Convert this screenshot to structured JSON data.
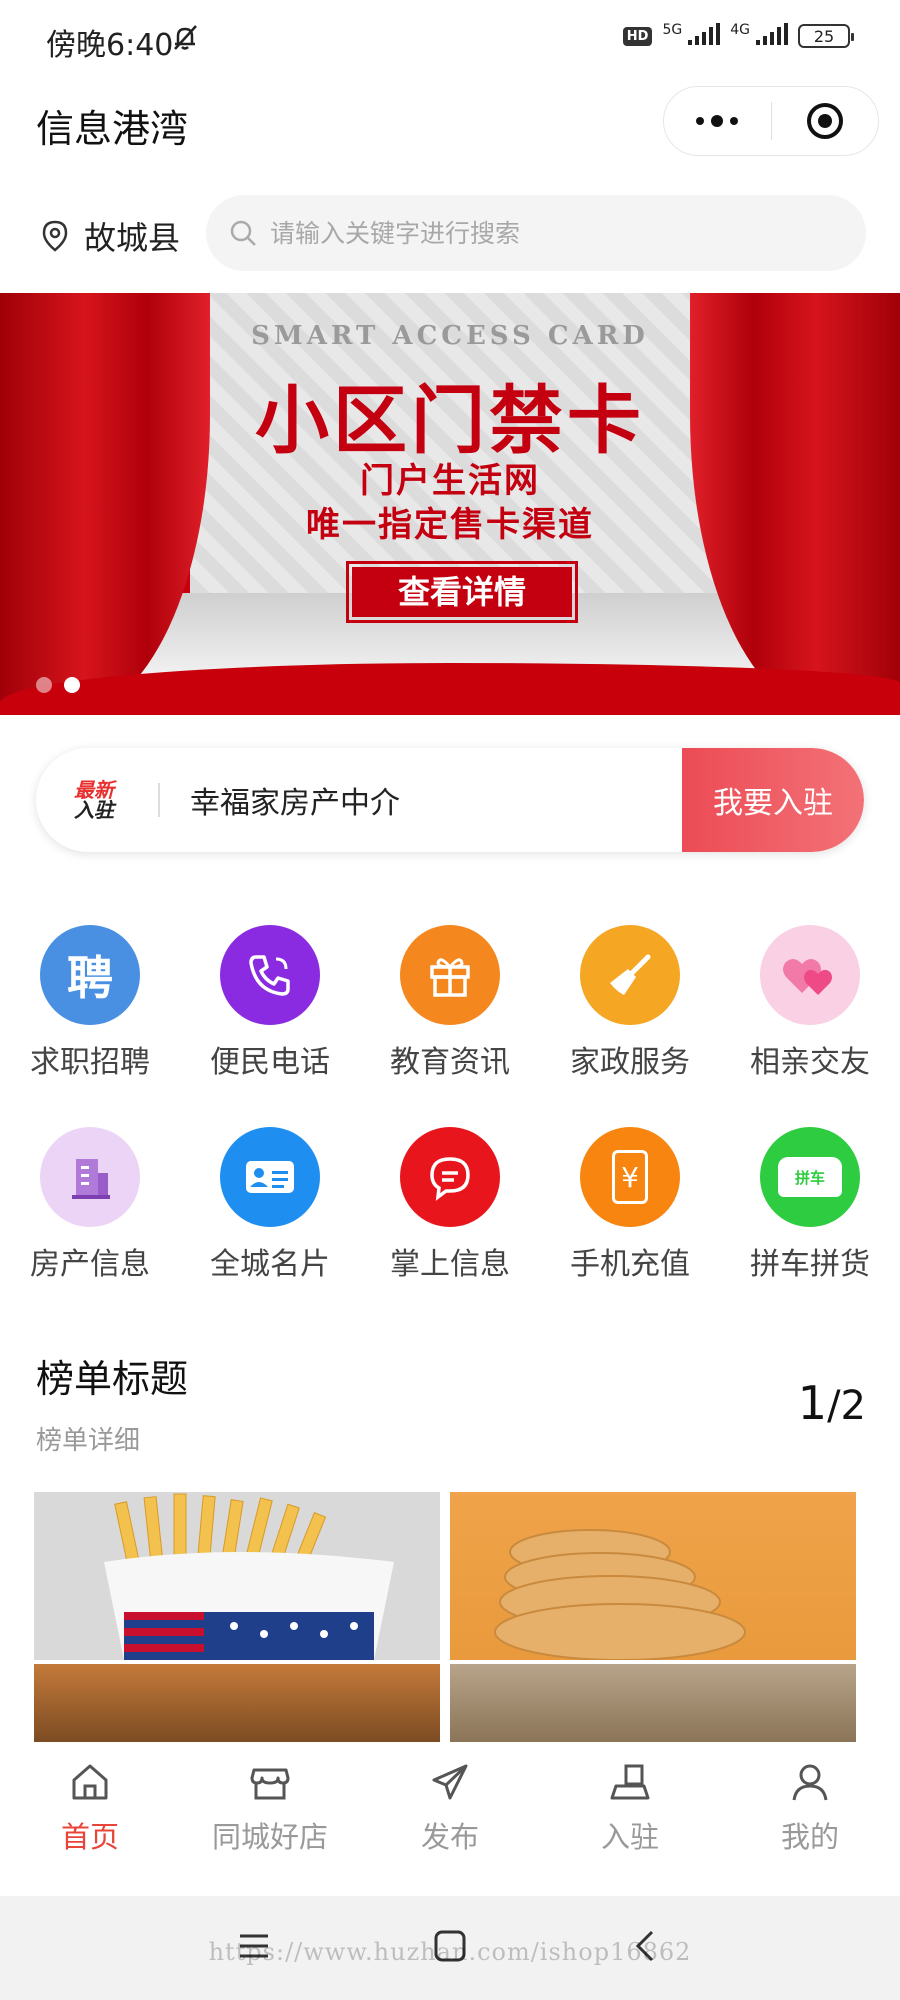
{
  "status": {
    "time": "傍晚6:40",
    "hd": "HD",
    "net1": "5G",
    "net2": "4G",
    "battery": "25"
  },
  "header": {
    "title": "信息港湾"
  },
  "location": {
    "city": "故城县"
  },
  "search": {
    "placeholder": "请输入关键字进行搜索"
  },
  "banner": {
    "subtitle": "SMART ACCESS CARD",
    "title": "小区门禁卡",
    "line1": "门户生活网",
    "line2": "唯一指定售卡渠道",
    "cta": "查看详情",
    "slide_count": 2,
    "active_slide": 2
  },
  "notice": {
    "badge_top": "最新",
    "badge_bottom": "入驻",
    "text": "幸福家房产中介",
    "join_label": "我要入驻"
  },
  "categories": [
    {
      "label": "求职招聘",
      "icon": "recruit-icon",
      "color": "#4a90e2"
    },
    {
      "label": "便民电话",
      "icon": "phone-icon",
      "color": "#8a2be2"
    },
    {
      "label": "教育资讯",
      "icon": "gift-icon",
      "color": "#f5871f"
    },
    {
      "label": "家政服务",
      "icon": "broom-icon",
      "color": "#f5a623"
    },
    {
      "label": "相亲交友",
      "icon": "hearts-icon",
      "color": "#f27aa8"
    },
    {
      "label": "房产信息",
      "icon": "building-icon",
      "color": "#b07ad9"
    },
    {
      "label": "全城名片",
      "icon": "card-icon",
      "color": "#1e8ff0"
    },
    {
      "label": "掌上信息",
      "icon": "chat-icon",
      "color": "#e8161c"
    },
    {
      "label": "手机充值",
      "icon": "recharge-icon",
      "color": "#f7850f"
    },
    {
      "label": "拼车拼货",
      "icon": "car-icon",
      "color": "#2ecc40"
    }
  ],
  "category_icon_text": {
    "recruit": "聘",
    "car": "拼车",
    "recharge": "¥"
  },
  "ranking": {
    "title": "榜单标题",
    "subtitle": "榜单详细",
    "page_current": "1",
    "page_total": "2"
  },
  "tabs": [
    {
      "label": "首页",
      "icon": "home-icon",
      "active": true
    },
    {
      "label": "同城好店",
      "icon": "shop-icon",
      "active": false
    },
    {
      "label": "发布",
      "icon": "send-icon",
      "active": false
    },
    {
      "label": "入驻",
      "icon": "join-icon",
      "active": false
    },
    {
      "label": "我的",
      "icon": "user-icon",
      "active": false
    }
  ],
  "watermark": "https://www.huzhan.com/ishop16862",
  "colors": {
    "accent": "#e8443a",
    "banner_red": "#c7000b",
    "join_gradient": "#ec4b55"
  }
}
